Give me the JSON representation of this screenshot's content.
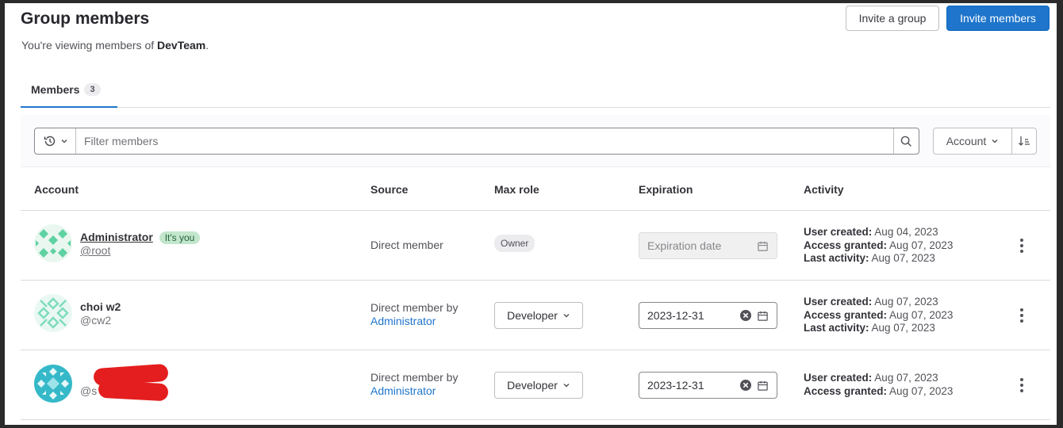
{
  "header": {
    "title": "Group members",
    "subtitle_prefix": "You're viewing members of ",
    "group_name": "DevTeam",
    "subtitle_suffix": ".",
    "invite_group_label": "Invite a group",
    "invite_members_label": "Invite members"
  },
  "tabs": [
    {
      "label": "Members",
      "count": "3"
    }
  ],
  "filter": {
    "placeholder": "Filter members",
    "sort_label": "Account"
  },
  "columns": [
    "Account",
    "Source",
    "Max role",
    "Expiration",
    "Activity"
  ],
  "members": [
    {
      "name": "Administrator",
      "username": "@root",
      "its_you": "It's you",
      "source": "Direct member",
      "source_by": "",
      "role": "Owner",
      "expiration": "Expiration date",
      "activity": [
        {
          "label": "User created:",
          "value": " Aug 04, 2023"
        },
        {
          "label": "Access granted:",
          "value": " Aug 07, 2023"
        },
        {
          "label": "Last activity:",
          "value": " Aug 07, 2023"
        }
      ]
    },
    {
      "name": "choi w2",
      "username": "@cw2",
      "source": "Direct member by",
      "source_by": "Administrator",
      "role": "Developer",
      "expiration": "2023-12-31",
      "activity": [
        {
          "label": "User created:",
          "value": " Aug 07, 2023"
        },
        {
          "label": "Access granted:",
          "value": " Aug 07, 2023"
        },
        {
          "label": "Last activity:",
          "value": " Aug 07, 2023"
        }
      ]
    },
    {
      "name": "",
      "username": "@s",
      "source": "Direct member by",
      "source_by": "Administrator",
      "role": "Developer",
      "expiration": "2023-12-31",
      "activity": [
        {
          "label": "User created:",
          "value": " Aug 07, 2023"
        },
        {
          "label": "Access granted:",
          "value": " Aug 07, 2023"
        }
      ]
    }
  ],
  "colors": {
    "primary": "#1f75cb",
    "its_you_bg": "#c3e6cd",
    "avatar_green": "#5fd2a2",
    "avatar_teal": "#35b9c9"
  }
}
